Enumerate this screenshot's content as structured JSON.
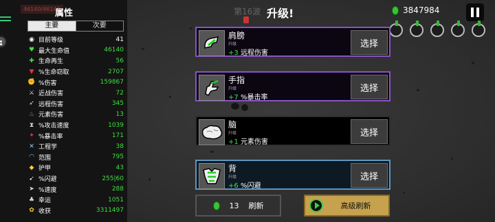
{
  "hp_bar_text": "46140/46140",
  "panel": {
    "title": "属性",
    "tabs": [
      {
        "label": "主要",
        "active": true
      },
      {
        "label": "次要",
        "active": false
      }
    ],
    "stats": [
      {
        "icon": "level-icon",
        "label": "目前等级",
        "value": "41",
        "color": "#ffffff"
      },
      {
        "icon": "heart-icon",
        "label": "最大生命值",
        "value": "46140",
        "color": "#3fe03f"
      },
      {
        "icon": "regen-icon",
        "label": "生命再生",
        "value": "56",
        "color": "#3fe03f"
      },
      {
        "icon": "vampire-icon",
        "label": "%生命窃取",
        "value": "2707",
        "color": "#3fe03f"
      },
      {
        "icon": "damage-icon",
        "label": "%伤害",
        "value": "159867",
        "color": "#3fe03f"
      },
      {
        "icon": "melee-icon",
        "label": "近战伤害",
        "value": "72",
        "color": "#3fe03f"
      },
      {
        "icon": "ranged-icon",
        "label": "远程伤害",
        "value": "345",
        "color": "#3fe03f"
      },
      {
        "icon": "elemental-icon",
        "label": "元素伤害",
        "value": "13",
        "color": "#3fe03f"
      },
      {
        "icon": "hourglass-icon",
        "label": "%攻击速度",
        "value": "1039",
        "color": "#3fe03f"
      },
      {
        "icon": "crit-icon",
        "label": "%暴击率",
        "value": "171",
        "color": "#3fe03f"
      },
      {
        "icon": "engineering-icon",
        "label": "工程学",
        "value": "38",
        "color": "#3fe03f"
      },
      {
        "icon": "range-icon",
        "label": "范围",
        "value": "795",
        "color": "#3fe03f"
      },
      {
        "icon": "armor-icon",
        "label": "护甲",
        "value": "43",
        "color": "#3fe03f"
      },
      {
        "icon": "dodge-icon",
        "label": "%闪避",
        "value": "255|60",
        "color": "#3fe03f"
      },
      {
        "icon": "speed-icon",
        "label": "%速度",
        "value": "288",
        "color": "#3fe03f"
      },
      {
        "icon": "luck-icon",
        "label": "幸运",
        "value": "1051",
        "color": "#3fe03f"
      },
      {
        "icon": "harvest-icon",
        "label": "收获",
        "value": "3311497",
        "color": "#3fe03f"
      }
    ]
  },
  "wave": "第16波",
  "title": "升级!",
  "currency": "3847984",
  "cards": [
    {
      "name": "肩膀",
      "sub": "升级",
      "bonus": "+3",
      "effect": "远程伤害",
      "button": "选择",
      "rarity": "purple"
    },
    {
      "name": "手指",
      "sub": "升级",
      "bonus": "+7",
      "effect": "%暴击率",
      "button": "选择",
      "rarity": "purple"
    },
    {
      "name": "脑",
      "sub": "升级",
      "bonus": "+1",
      "effect": "元素伤害",
      "button": "选择",
      "rarity": "common"
    },
    {
      "name": "背",
      "sub": "升级",
      "bonus": "+6",
      "effect": "%闪避",
      "button": "选择",
      "rarity": "blue"
    }
  ],
  "reroll": {
    "cost": "13",
    "label": "刷新"
  },
  "advanced_reroll": {
    "label": "高级刷新"
  },
  "colors": {
    "positive": "#3fe03f",
    "purple": "#8a52c6",
    "blue": "#5f96bf",
    "gold": "#c7a24e"
  }
}
